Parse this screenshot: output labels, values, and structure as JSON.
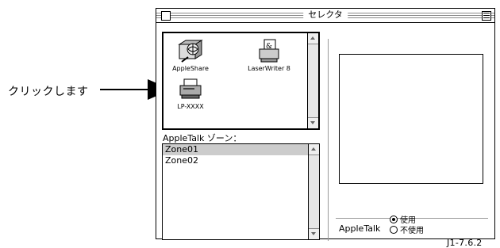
{
  "callout": {
    "text": "クリックします"
  },
  "window": {
    "title": "セレクタ",
    "icons": [
      {
        "label": "AppleShare",
        "icon": "appleshare-icon"
      },
      {
        "label": "LaserWriter 8",
        "icon": "laserwriter-icon"
      },
      {
        "label": "LP-XXXX",
        "icon": "printer-icon"
      }
    ],
    "zone_label": "AppleTalk ゾーン：",
    "zones": [
      "Zone01",
      "Zone02"
    ],
    "selected_zone": "Zone01",
    "appletalk_label": "AppleTalk",
    "radio_on": "使用",
    "radio_off": "不使用",
    "version": "J1-7.6.2"
  }
}
